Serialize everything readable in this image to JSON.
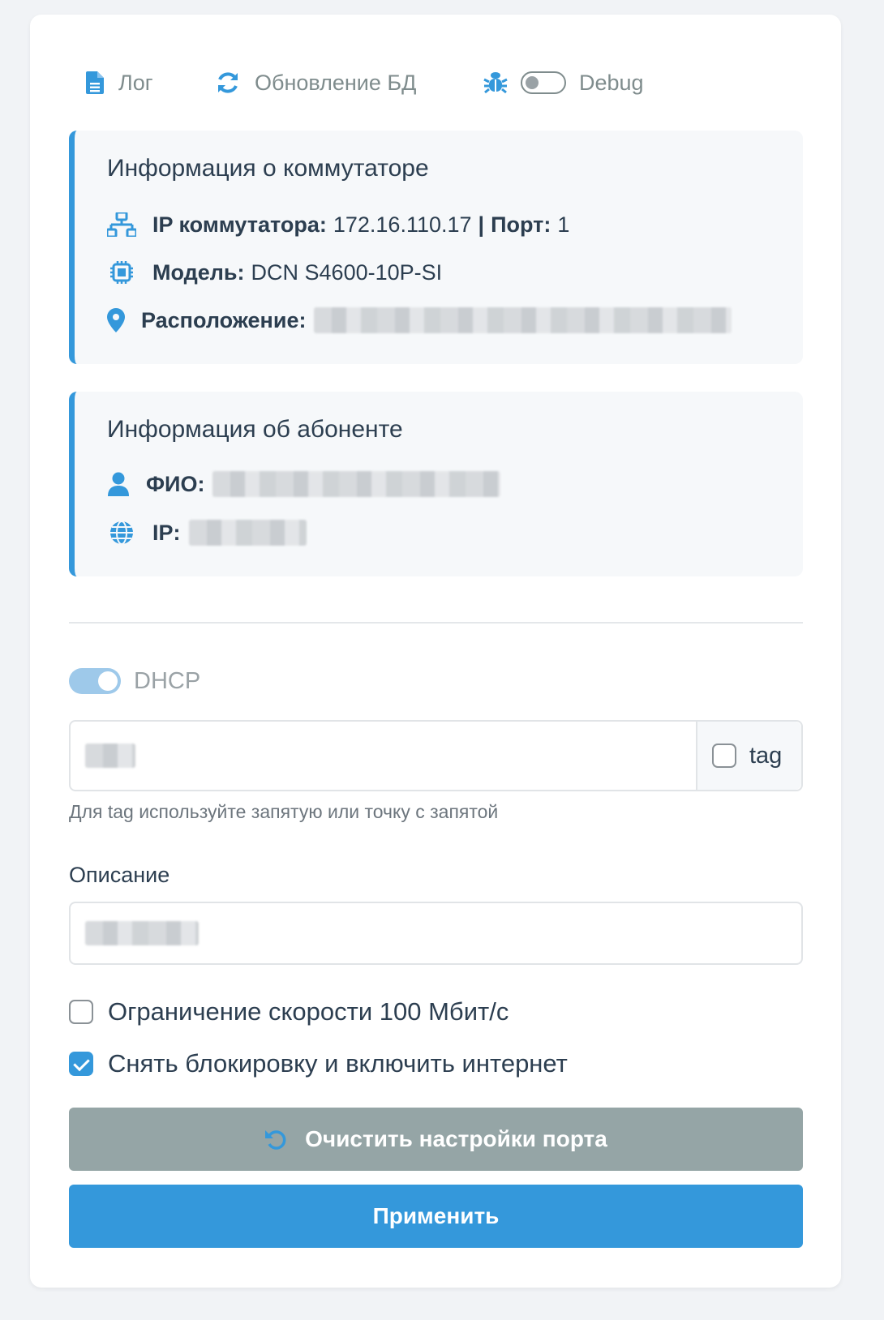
{
  "toolbar": {
    "log_label": "Лог",
    "update_db_label": "Обновление БД",
    "debug_label": "Debug",
    "debug_enabled": false
  },
  "switch_info": {
    "title": "Информация о коммутаторе",
    "ip_label": "IP коммутатора:",
    "ip_value": "172.16.110.17",
    "separator": "|",
    "port_label": "Порт:",
    "port_value": "1",
    "model_label": "Модель:",
    "model_value": "DCN S4600-10P-SI",
    "location_label": "Расположение:"
  },
  "subscriber_info": {
    "title": "Информация об абоненте",
    "name_label": "ФИО:",
    "ip_label": "IP:"
  },
  "form": {
    "dhcp_label": "DHCP",
    "dhcp_enabled": true,
    "tag_label": "tag",
    "tag_checked": false,
    "vlan_help": "Для tag используйте запятую или точку с запятой",
    "description_label": "Описание",
    "speed_limit_label": "Ограничение скорости 100 Мбит/с",
    "speed_limit_checked": false,
    "unblock_label": "Снять блокировку и включить интернет",
    "unblock_checked": true,
    "reset_button_label": "Очистить настройки порта",
    "apply_button_label": "Применить"
  },
  "colors": {
    "accent": "#3498db",
    "muted": "#95a5a6"
  }
}
